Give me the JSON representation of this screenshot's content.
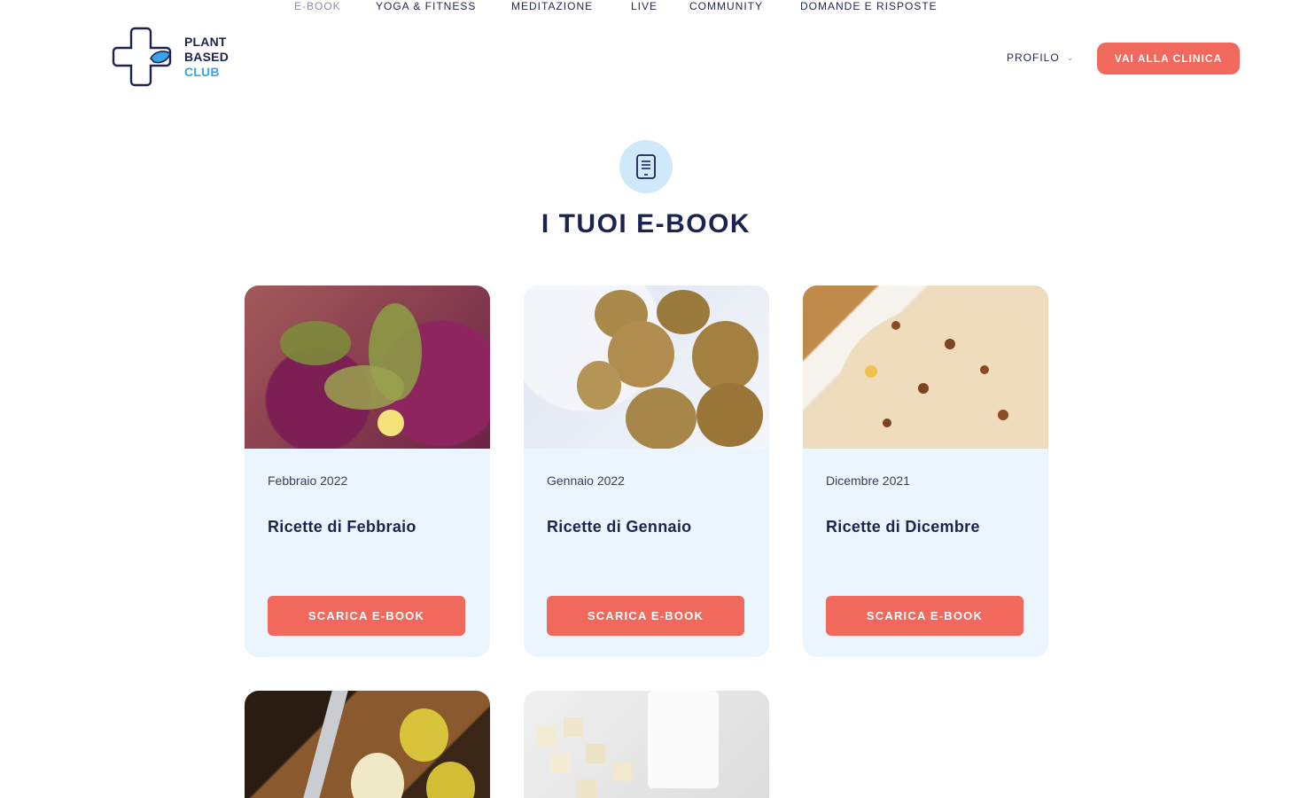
{
  "brand": {
    "line1": "PLANT",
    "line2": "BASED",
    "line3": "CLUB",
    "accent_color": "#37a6e8",
    "icon": "cross-leaf-logo-icon"
  },
  "nav": {
    "items": [
      {
        "label": "E-BOOK",
        "active": true
      },
      {
        "label": "YOGA & FITNESS",
        "active": false
      },
      {
        "label": "MEDITAZIONE",
        "active": false
      },
      {
        "label": "LIVE",
        "active": false
      },
      {
        "label": "COMMUNITY",
        "active": false
      },
      {
        "label": "DOMANDE E RISPOSTE",
        "active": false
      }
    ],
    "profile_label": "PROFILO",
    "profile_icon": "chevron-down-icon",
    "clinic_button": "VAI ALLA CLINICA"
  },
  "page": {
    "icon": "ebook-icon",
    "title": "I TUOI E-BOOK"
  },
  "cards": [
    {
      "date": "Febbraio 2022",
      "title": "Ricette di Febbraio",
      "button": "SCARICA E-BOOK",
      "image": "food-photo-february"
    },
    {
      "date": "Gennaio 2022",
      "title": "Ricette di Gennaio",
      "button": "SCARICA E-BOOK",
      "image": "food-photo-january"
    },
    {
      "date": "Dicembre 2021",
      "title": "Ricette di Dicembre",
      "button": "SCARICA E-BOOK",
      "image": "food-photo-december"
    }
  ],
  "colors": {
    "primary_button": "#f0695c",
    "card_background": "#eaf5fd",
    "title_text": "#1b2450"
  }
}
